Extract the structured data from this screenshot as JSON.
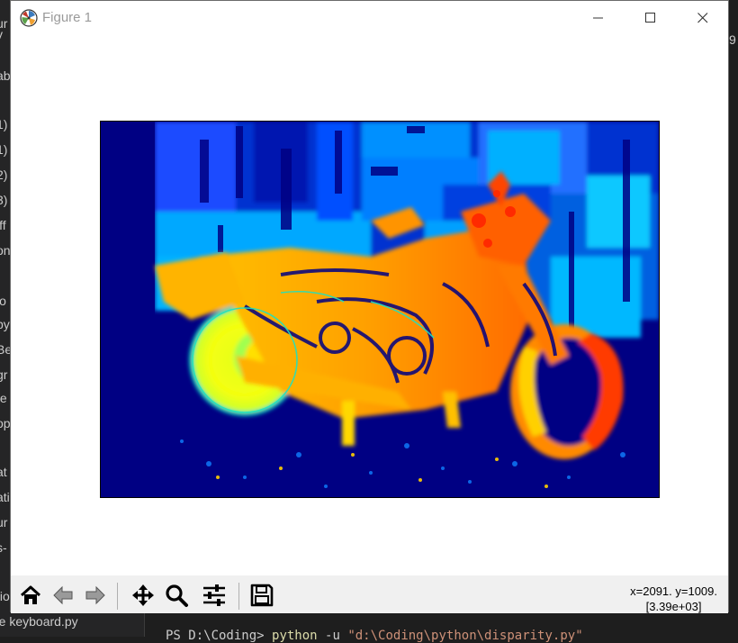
{
  "window": {
    "title": "Figure 1"
  },
  "toolbar": {
    "buttons": [
      {
        "name": "home-button",
        "icon": "home-icon"
      },
      {
        "name": "back-button",
        "icon": "arrow-left-icon"
      },
      {
        "name": "forward-button",
        "icon": "arrow-right-icon"
      },
      {
        "name": "pan-button",
        "icon": "move-icon"
      },
      {
        "name": "zoom-button",
        "icon": "magnifier-icon"
      },
      {
        "name": "configure-subplots-button",
        "icon": "sliders-icon"
      },
      {
        "name": "save-button",
        "icon": "floppy-disk-icon"
      }
    ],
    "coords_line1": "x=2091. y=1009.",
    "coords_line2": "[3.39e+03]"
  },
  "plot": {
    "colormap": "jet",
    "image_description_icon": "disparity-map-image"
  },
  "background": {
    "editor_fragments": [
      "ur",
      "y",
      "ab",
      "1)",
      "1)",
      "2)",
      "3)",
      "iff",
      "on",
      "io",
      "py",
      "Be",
      "gr",
      "te",
      "op",
      "at",
      "ati",
      "ur",
      "s-",
      "tio"
    ],
    "bottom_left_text": "re keyboard.py",
    "terminal_prompt": "PS D:\\Coding>",
    "terminal_cmd": "python",
    "terminal_sep": "-u",
    "terminal_path": "\"d:\\Coding\\python\\disparity.py\"",
    "right_fragment": "9"
  }
}
